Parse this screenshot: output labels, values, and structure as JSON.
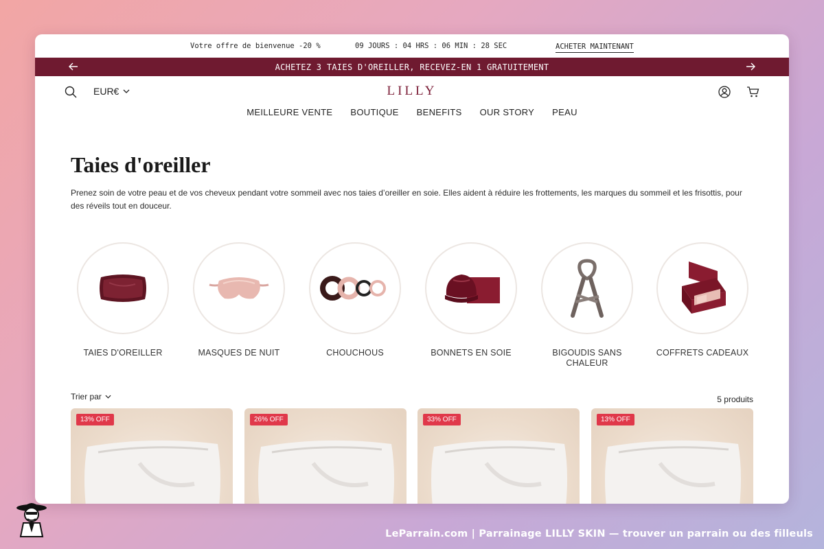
{
  "topbar": {
    "offer": "Votre offre de bienvenue -20 %",
    "timer": "09 JOURS : 04 HRS : 06 MIN : 28 SEC",
    "buy_label": "ACHETER MAINTENANT"
  },
  "promo": {
    "text": "ACHETEZ 3 TAIES D'OREILLER, RECEVEZ-EN 1 GRATUITEMENT"
  },
  "header": {
    "currency": "EUR€",
    "logo": "LILLY"
  },
  "nav": {
    "items": [
      "MEILLEURE VENTE",
      "BOUTIQUE",
      "BENEFITS",
      "OUR STORY",
      "PEAU"
    ]
  },
  "page": {
    "title": "Taies d'oreiller",
    "description": "Prenez soin de votre peau et de vos cheveux pendant votre sommeil avec nos taies d’oreiller en soie. Elles aident à réduire les frottements, les marques du sommeil et les frisottis, pour des réveils tout en douceur."
  },
  "categories": [
    {
      "label": "TAIES D'OREILLER",
      "icon": "pillowcase-icon"
    },
    {
      "label": "MASQUES DE NUIT",
      "icon": "sleep-mask-icon"
    },
    {
      "label": "CHOUCHOUS",
      "icon": "scrunchies-icon"
    },
    {
      "label": "BONNETS EN SOIE",
      "icon": "silk-bonnet-icon"
    },
    {
      "label": "BIGOUDIS SANS CHALEUR",
      "icon": "heatless-curler-icon"
    },
    {
      "label": "COFFRETS CADEAUX",
      "icon": "gift-box-icon"
    }
  ],
  "toolbar": {
    "sort_label": "Trier par",
    "count": "5 produits"
  },
  "products": [
    {
      "badge": "13% OFF"
    },
    {
      "badge": "26% OFF"
    },
    {
      "badge": "33% OFF"
    },
    {
      "badge": "13% OFF"
    }
  ],
  "footer": {
    "text": "LeParrain.com | Parrainage LILLY SKIN — trouver un parrain ou des filleuls"
  },
  "colors": {
    "brand": "#6f1a30",
    "badge": "#e0384a"
  }
}
